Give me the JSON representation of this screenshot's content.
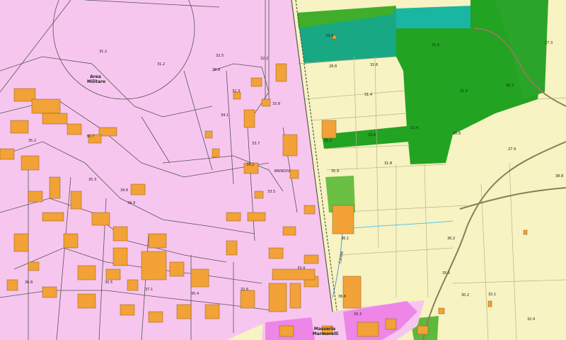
{
  "map": {
    "colors": {
      "urban": "#f7c6ee",
      "urban_alt": "#ef7ce6",
      "farmland": "#f7f3c2",
      "forest": "#1fa11f",
      "forest_light": "#5fbf3a",
      "wetland": "#17a87a",
      "teal": "#19b9a0",
      "building": "#f2a236",
      "building_outline": "#8a5a1a",
      "road_line": "#333333",
      "road_rural": "#8b7d5a",
      "canal": "#57c6f0"
    },
    "place_labels": [
      {
        "id": "area-militare",
        "lines": [
          "Area",
          "Militare"
        ]
      },
      {
        "id": "brindisi",
        "lines": [
          "BRINDISI"
        ]
      },
      {
        "id": "masseria-marmorelli",
        "lines": [
          "Masseria",
          "Marmorelli"
        ]
      },
      {
        "id": "canale",
        "lines": [
          "Canale"
        ]
      }
    ],
    "elevation_labels": [
      "31.2",
      "31.2",
      "32.2",
      "32.3",
      "34.1",
      "33.7",
      "34.2",
      "33.5",
      "33.8",
      "33.9",
      "31.4",
      "32.6",
      "31.6",
      "31.5",
      "30.7",
      "27.3",
      "27.9",
      "30.8",
      "32.4",
      "33.8",
      "31.8",
      "35.2",
      "35.9",
      "36.1",
      "36.2",
      "35.5",
      "30.2",
      "32.1",
      "32.4",
      "38.8",
      "35.2",
      "39.9",
      "35.3",
      "30.7",
      "36.8",
      "35.5",
      "37.1",
      "35.4",
      "32.6",
      "33.4",
      "38.8",
      "32.5",
      "36.6",
      "30.3",
      "28.8",
      "34.6"
    ]
  }
}
